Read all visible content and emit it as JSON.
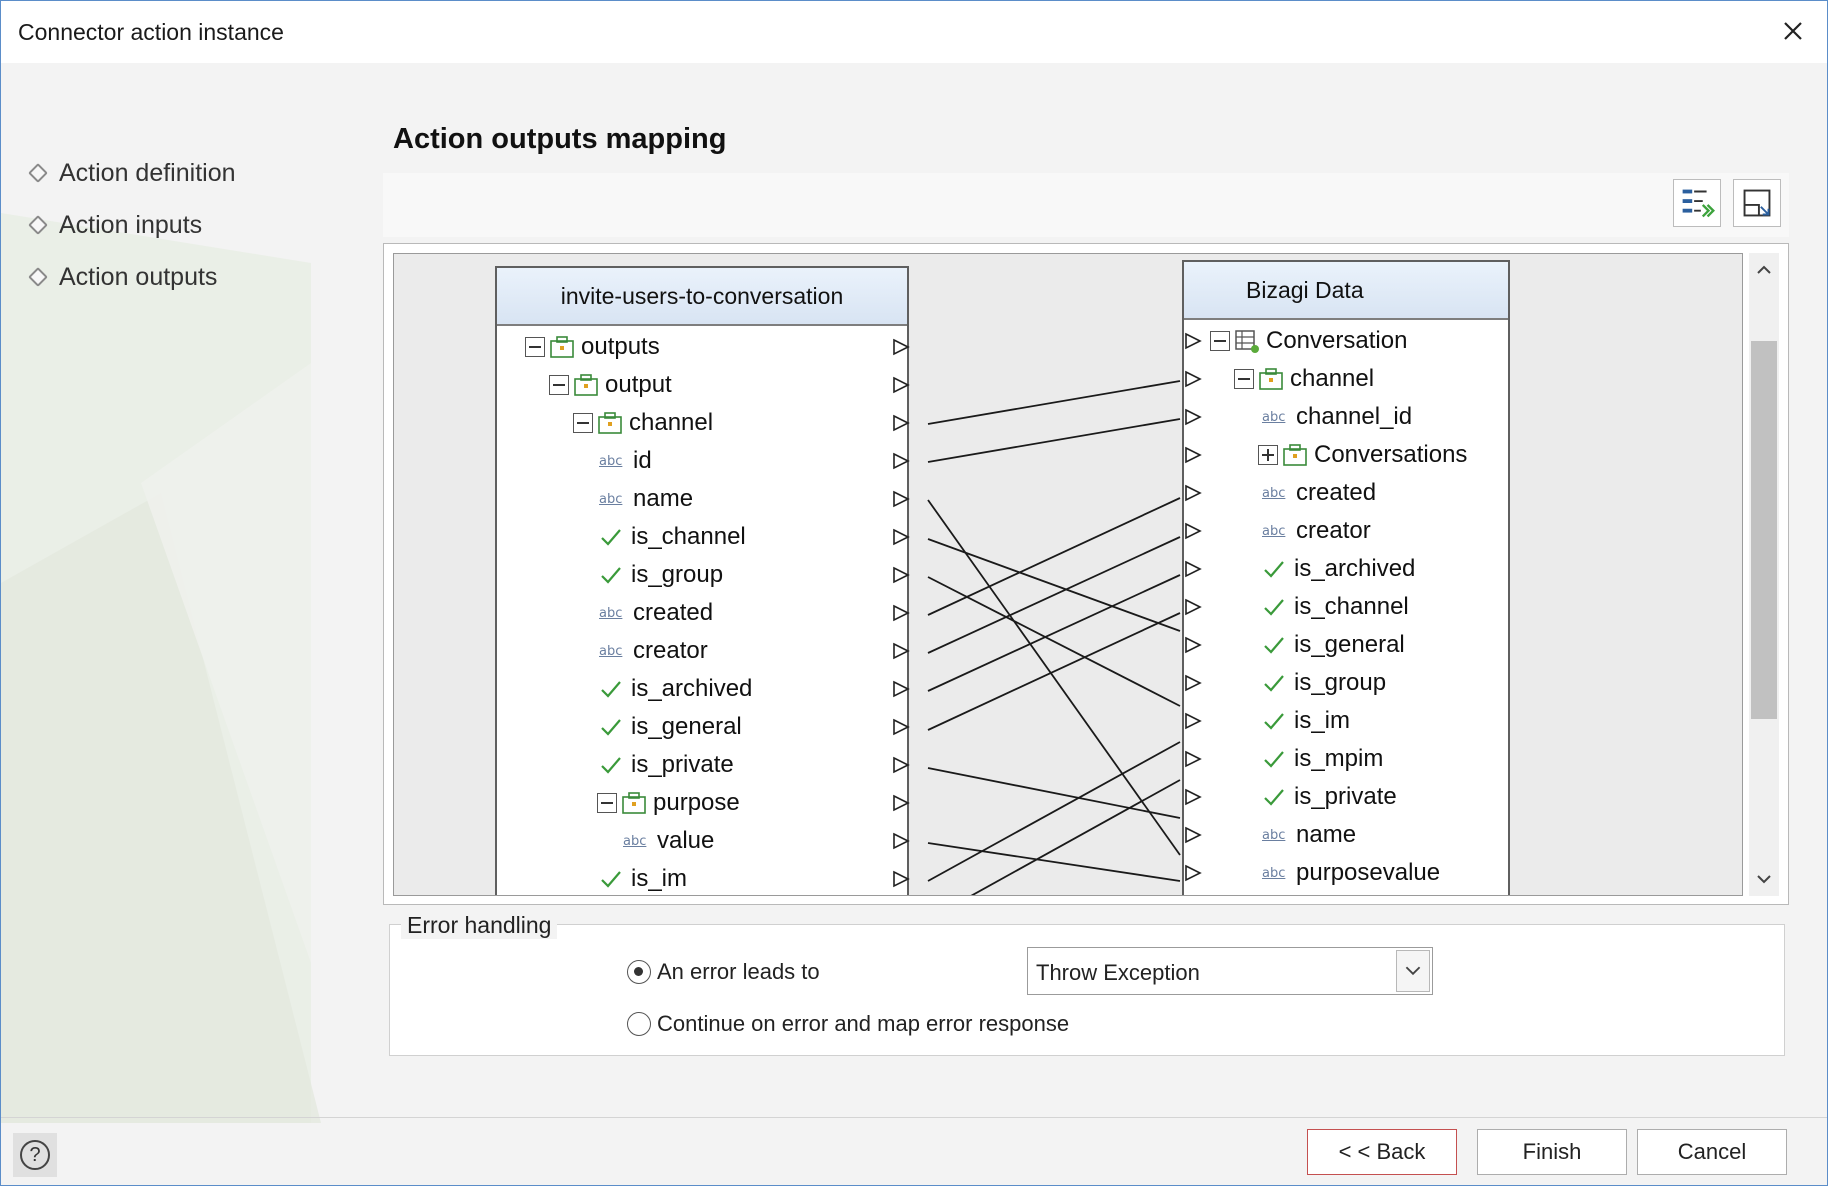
{
  "window": {
    "title": "Connector action instance"
  },
  "nav": {
    "items": [
      "Action definition",
      "Action inputs",
      "Action outputs"
    ]
  },
  "section": {
    "title": "Action outputs mapping"
  },
  "left_tree": {
    "header": "invite-users-to-conversation",
    "rows": [
      "outputs",
      "output",
      "channel",
      "id",
      "name",
      "is_channel",
      "is_group",
      "created",
      "creator",
      "is_archived",
      "is_general",
      "is_private",
      "purpose",
      "value",
      "is_im"
    ]
  },
  "right_tree": {
    "header": "Bizagi Data",
    "rows": [
      "Conversation",
      "channel",
      "channel_id",
      "Conversations",
      "created",
      "creator",
      "is_archived",
      "is_channel",
      "is_general",
      "is_group",
      "is_im",
      "is_mpim",
      "is_private",
      "name",
      "purposevalue"
    ]
  },
  "icons": {
    "string_type": "abc"
  },
  "error_handling": {
    "legend": "Error handling",
    "option1": "An error leads to",
    "option2": "Continue on error and map error response",
    "selected": "Throw Exception"
  },
  "footer": {
    "help": "?",
    "back": "< < Back",
    "finish": "Finish",
    "cancel": "Cancel"
  }
}
